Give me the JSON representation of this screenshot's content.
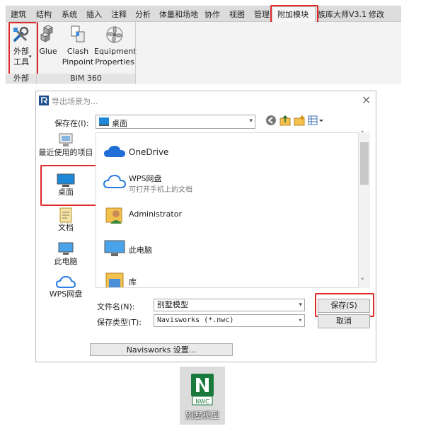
{
  "ribbon": {
    "tabs": [
      "建筑",
      "结构",
      "系统",
      "插入",
      "注释",
      "分析",
      "体量和场地",
      "协作",
      "视图",
      "管理",
      "附加模块",
      "族库大师V3.1",
      "修改"
    ],
    "active_tab": "附加模块",
    "tools": [
      {
        "label_line1": "外部",
        "label_line2": "工具",
        "icon": "external-tools-icon"
      },
      {
        "label_line1": "Glue",
        "label_line2": "",
        "icon": "glue-cubes-icon"
      },
      {
        "label_line1": "Clash",
        "label_line2": "Pinpoint",
        "icon": "clash-pinpoint-icon"
      },
      {
        "label_line1": "Equipment",
        "label_line2": "Properties",
        "icon": "equipment-fan-icon"
      }
    ],
    "panels": [
      "外部",
      "BIM 360"
    ]
  },
  "dialog": {
    "title": "导出场景为...",
    "save_in_label": "保存在(I):",
    "location": "桌面",
    "places": [
      "最近使用的项目",
      "桌面",
      "文档",
      "此电脑",
      "WPS网盘"
    ],
    "files": [
      {
        "name": "OneDrive",
        "sub": "",
        "icon": "onedrive-cloud-icon"
      },
      {
        "name": "WPS网盘",
        "sub": "可打开手机上的文档",
        "icon": "wps-cloud-icon"
      },
      {
        "name": "Administrator",
        "sub": "",
        "icon": "user-folder-icon"
      },
      {
        "name": "此电脑",
        "sub": "",
        "icon": "computer-icon"
      },
      {
        "name": "库",
        "sub": "",
        "icon": "library-folder-icon"
      }
    ],
    "filename_label": "文件名(N):",
    "filename_value": "别墅模型",
    "filetype_label": "保存类型(T):",
    "filetype_value": "Navisworks (*.nwc)",
    "save_button": "保存(S)",
    "cancel_button": "取消",
    "settings_button": "Navisworks 设置..."
  },
  "output_file": {
    "badge": "NWC",
    "name": "别墅模型"
  },
  "colors": {
    "highlight_red": "#e02a2a",
    "desktop_blue": "#1e88d8",
    "nwc_green": "#1a7a3c"
  }
}
